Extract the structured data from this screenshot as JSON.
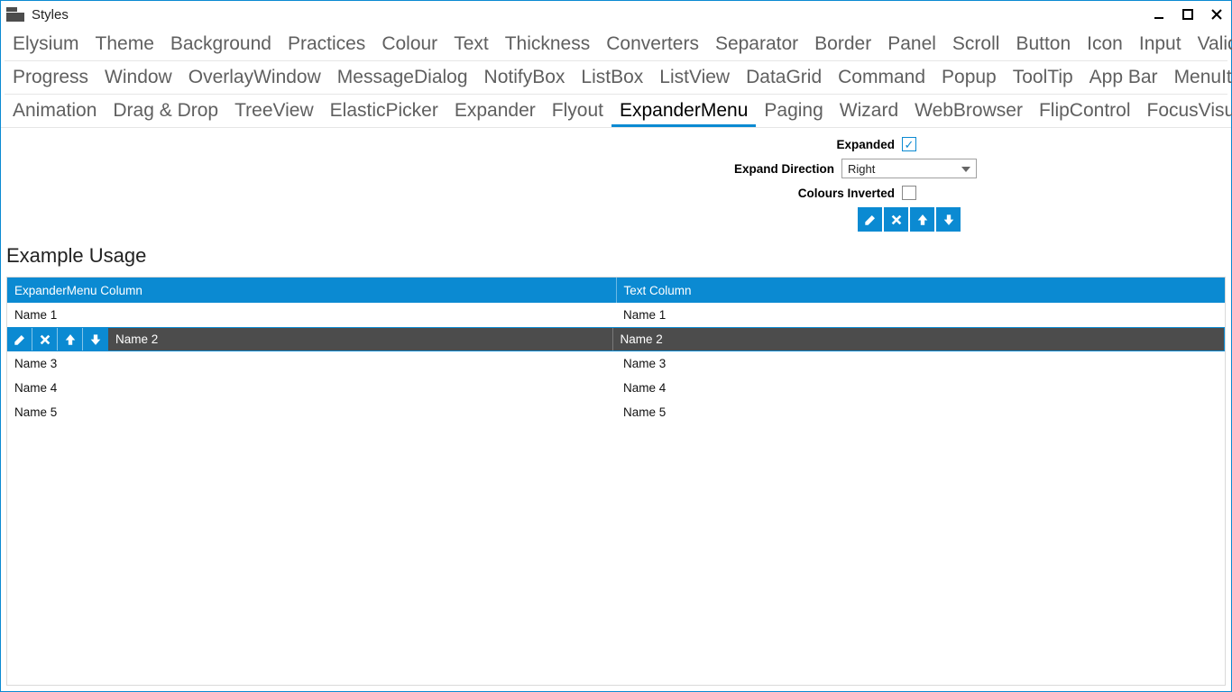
{
  "window": {
    "title": "Styles"
  },
  "tabs": {
    "row1": [
      "Elysium",
      "Theme",
      "Background",
      "Practices",
      "Colour",
      "Text",
      "Thickness",
      "Converters",
      "Separator",
      "Border",
      "Panel",
      "Scroll",
      "Button",
      "Icon",
      "Input",
      "Validation"
    ],
    "row2": [
      "Progress",
      "Window",
      "OverlayWindow",
      "MessageDialog",
      "NotifyBox",
      "ListBox",
      "ListView",
      "DataGrid",
      "Command",
      "Popup",
      "ToolTip",
      "App Bar",
      "MenuItem"
    ],
    "row3": [
      "Animation",
      "Drag & Drop",
      "TreeView",
      "ElasticPicker",
      "Expander",
      "Flyout",
      "ExpanderMenu",
      "Paging",
      "Wizard",
      "WebBrowser",
      "FlipControl",
      "FocusVisualStyle"
    ],
    "active": "ExpanderMenu"
  },
  "form": {
    "expanded_label": "Expanded",
    "expanded_checked": true,
    "direction_label": "Expand Direction",
    "direction_value": "Right",
    "inverted_label": "Colours Inverted",
    "inverted_checked": false
  },
  "icons": {
    "edit": "edit-icon",
    "close": "close-icon",
    "up": "arrow-up-icon",
    "down": "arrow-down-icon"
  },
  "section_title": "Example Usage",
  "grid": {
    "columns": [
      "ExpanderMenu Column",
      "Text Column"
    ],
    "rows": [
      {
        "c1": "Name 1",
        "c2": "Name 1",
        "selected": false
      },
      {
        "c1": "Name 2",
        "c2": "Name 2",
        "selected": true
      },
      {
        "c1": "Name 3",
        "c2": "Name 3",
        "selected": false
      },
      {
        "c1": "Name 4",
        "c2": "Name 4",
        "selected": false
      },
      {
        "c1": "Name 5",
        "c2": "Name 5",
        "selected": false
      }
    ]
  },
  "colors": {
    "accent": "#0b8ad2"
  }
}
